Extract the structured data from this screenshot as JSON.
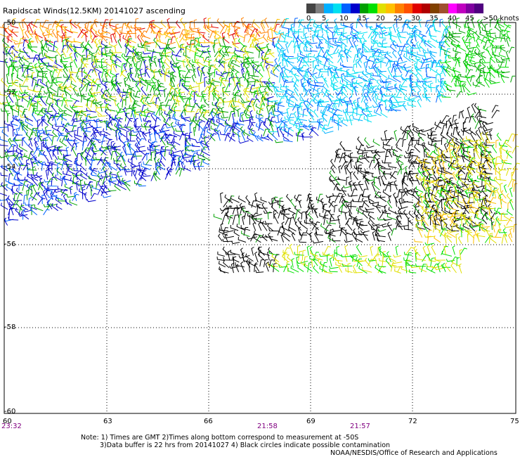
{
  "title": "Rapidscat Winds(12.5KM) 20141027 ascending",
  "legend": {
    "colors": [
      "#444444",
      "#808080",
      "#00b0ff",
      "#00e0f0",
      "#0060ff",
      "#0000cc",
      "#00a000",
      "#00e000",
      "#e0e000",
      "#ffc000",
      "#ff8000",
      "#ff5000",
      "#e00000",
      "#b00000",
      "#804000",
      "#a05030",
      "#ff00ff",
      "#c000c0",
      "#8000a0",
      "#500080"
    ],
    "labels": [
      "0",
      "5",
      "10",
      "15",
      "20",
      "25",
      "30",
      "35",
      "40",
      "45",
      ">50 knots"
    ]
  },
  "axes": {
    "y_labels": [
      "-50",
      "-52",
      "-54",
      "-56",
      "-58",
      "-60"
    ],
    "x_labels": [
      "60",
      "63",
      "66",
      "69",
      "72",
      "75"
    ],
    "time_labels": [
      "23:32",
      "21:58",
      "21:57"
    ]
  },
  "note": {
    "line1": "Note: 1) Times are GMT 2)Times along bottom correspond to measurement at -50S",
    "line2": "3)Data buffer is 22 hrs from 20141027 4) Black circles indicate possible contamination"
  },
  "credit": "NOAA/NESDIS/Office of Research and Applications"
}
